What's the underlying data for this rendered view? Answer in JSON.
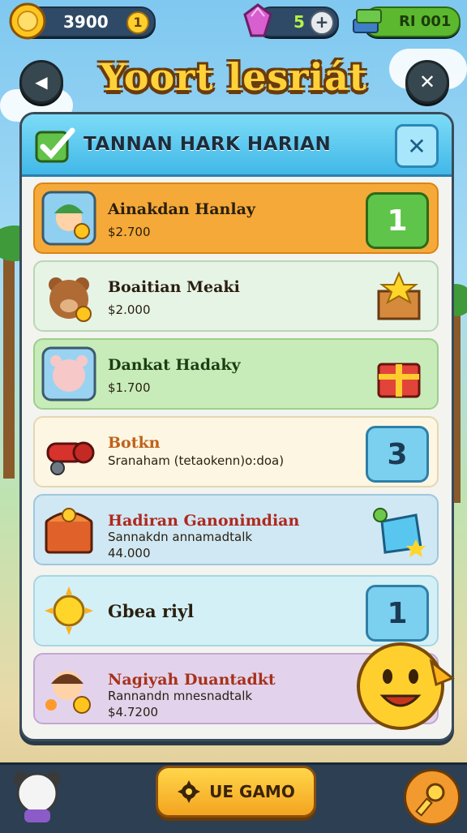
{
  "top_bar": {
    "coins": "3900",
    "coin_level": "1",
    "gems": "5",
    "gem_add": "+",
    "ticket": "RI 001"
  },
  "header": {
    "title": "Yoort lesriát",
    "back_symbol": "◀",
    "close_symbol": "✕"
  },
  "panel": {
    "title": "TANNAN HARK HARIAN",
    "close_symbol": "✕"
  },
  "rows": [
    {
      "name": "Ainakdan Hanlay",
      "line1": "$2.700",
      "line2": "",
      "badge": "1",
      "color": "#f5a938"
    },
    {
      "name": "Boaitian Meaki",
      "line1": "$2.000",
      "line2": "",
      "badge": "",
      "color": "#e6f4e6"
    },
    {
      "name": "Dankat Hadaky",
      "line1": "$1.700",
      "line2": "",
      "badge": "",
      "color": "#c7ecb9"
    },
    {
      "name": "Botkn",
      "line1": "Sranaham (tetaokenn)o:doa)",
      "line2": "",
      "badge": "3",
      "color": "#fcf6e2"
    },
    {
      "name": "Hadiran Ganonimdian",
      "line1": "Sannakdn annamadtalk",
      "line2": "44.000",
      "badge": "",
      "color": "#cfe8f4"
    },
    {
      "name": "Gbea riyl",
      "line1": "",
      "line2": "",
      "badge": "1",
      "color": "#d3f0f6"
    },
    {
      "name": "Nagiyah Duantadkt",
      "line1": "Rannandn mnesnadtalk",
      "line2": "$4.7200",
      "badge": "",
      "color": "#e3d2ec"
    }
  ],
  "bottom": {
    "button_label": "UE GAMO"
  },
  "colors": {
    "badge_green": "#5fc44a",
    "badge_blue": "#7cd0ef",
    "title_gold": "#ffd23a"
  }
}
